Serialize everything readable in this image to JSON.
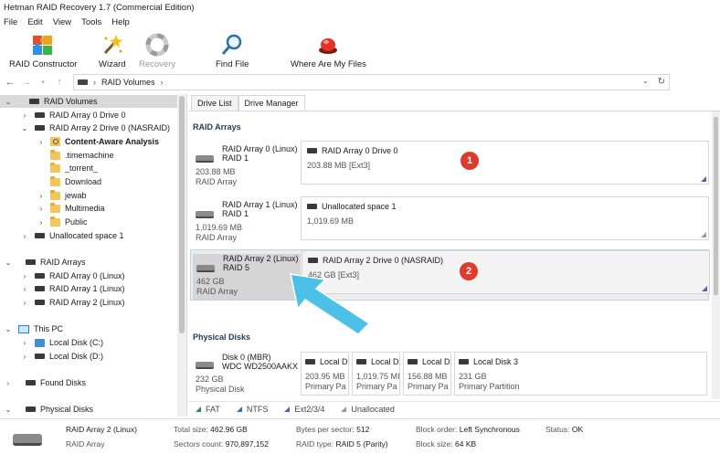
{
  "window": {
    "title": "Hetman RAID Recovery 1.7 (Commercial Edition)"
  },
  "menu": [
    "File",
    "Edit",
    "View",
    "Tools",
    "Help"
  ],
  "toolbar": {
    "raid_constructor": "RAID Constructor",
    "wizard": "Wizard",
    "recovery": "Recovery",
    "find_file": "Find File",
    "where_are_my_files": "Where Are My Files"
  },
  "address": {
    "path": "RAID Volumes",
    "sep": "›"
  },
  "tree": {
    "raid_volumes": "RAID Volumes",
    "vol0": "RAID Array 0 Drive 0",
    "vol2": "RAID Array 2 Drive 0 (NASRAID)",
    "content_aware": "Content-Aware Analysis",
    "folders": [
      ".timemachine",
      "_torrent_",
      "Download",
      "jewab",
      "Multimedia",
      "Public"
    ],
    "unallocated": "Unallocated space 1",
    "raid_arrays": "RAID Arrays",
    "arrays": [
      "RAID Array 0 (Linux)",
      "RAID Array 1 (Linux)",
      "RAID Array 2 (Linux)"
    ],
    "this_pc": "This PC",
    "local_c": "Local Disk (C:)",
    "local_d": "Local Disk (D:)",
    "found_disks": "Found Disks",
    "physical_disks": "Physical Disks"
  },
  "tabs": {
    "drive_list": "Drive List",
    "drive_manager": "Drive Manager"
  },
  "sections": {
    "raid_arrays": "RAID Arrays",
    "physical_disks": "Physical Disks"
  },
  "arrays": [
    {
      "name": "RAID Array 0 (Linux)",
      "level": "RAID 1",
      "size": "203.88 MB",
      "kind": "RAID Array",
      "part_name": "RAID Array 0 Drive 0",
      "part_size": "203.88 MB [Ext3]",
      "badge": "1"
    },
    {
      "name": "RAID Array 1 (Linux)",
      "level": "RAID 1",
      "size": "1,019.69 MB",
      "kind": "RAID Array",
      "part_name": "Unallocated space 1",
      "part_size": "1,019.69 MB",
      "badge": ""
    },
    {
      "name": "RAID Array 2 (Linux)",
      "level": "RAID 5",
      "size": "462 GB",
      "kind": "RAID Array",
      "part_name": "RAID Array 2 Drive 0 (NASRAID)",
      "part_size": "462 GB [Ext3]",
      "badge": "2"
    }
  ],
  "physical": {
    "name": "Disk 0 (MBR)",
    "model": "WDC WD2500AAKX",
    "size": "232 GB",
    "kind": "Physical Disk",
    "partitions": [
      {
        "name": "Local D",
        "size": "203.95 MB",
        "kind": "Primary Pa"
      },
      {
        "name": "Local D",
        "size": "1,019.75 MI",
        "kind": "Primary Pa"
      },
      {
        "name": "Local D",
        "size": "156.88 MB",
        "kind": "Primary Pa"
      },
      {
        "name": "Local Disk 3",
        "size": "231 GB",
        "kind": "Primary Partition"
      }
    ]
  },
  "legend": [
    {
      "label": "FAT",
      "color": "#2e8b57"
    },
    {
      "label": "NTFS",
      "color": "#2f6fd0"
    },
    {
      "label": "Ext2/3/4",
      "color": "#7a4fb5"
    },
    {
      "label": "Unallocated",
      "color": "#999999"
    }
  ],
  "status": {
    "name": "RAID Array 2 (Linux)",
    "kind": "RAID Array",
    "total_size_label": "Total size:",
    "total_size": "462.96 GB",
    "sectors_label": "Sectors count:",
    "sectors": "970,897,152",
    "bps_label": "Bytes per sector:",
    "bps": "512",
    "raid_type_label": "RAID type:",
    "raid_type": "RAID 5 (Parity)",
    "block_order_label": "Block order:",
    "block_order": "Left Synchronous",
    "block_size_label": "Block size:",
    "block_size": "64 KB",
    "status_label": "Status:",
    "status": "OK"
  },
  "colors": {
    "badge": "#e03a2c",
    "arrow": "#4cc0e6",
    "ext": "#7a4fb5"
  }
}
